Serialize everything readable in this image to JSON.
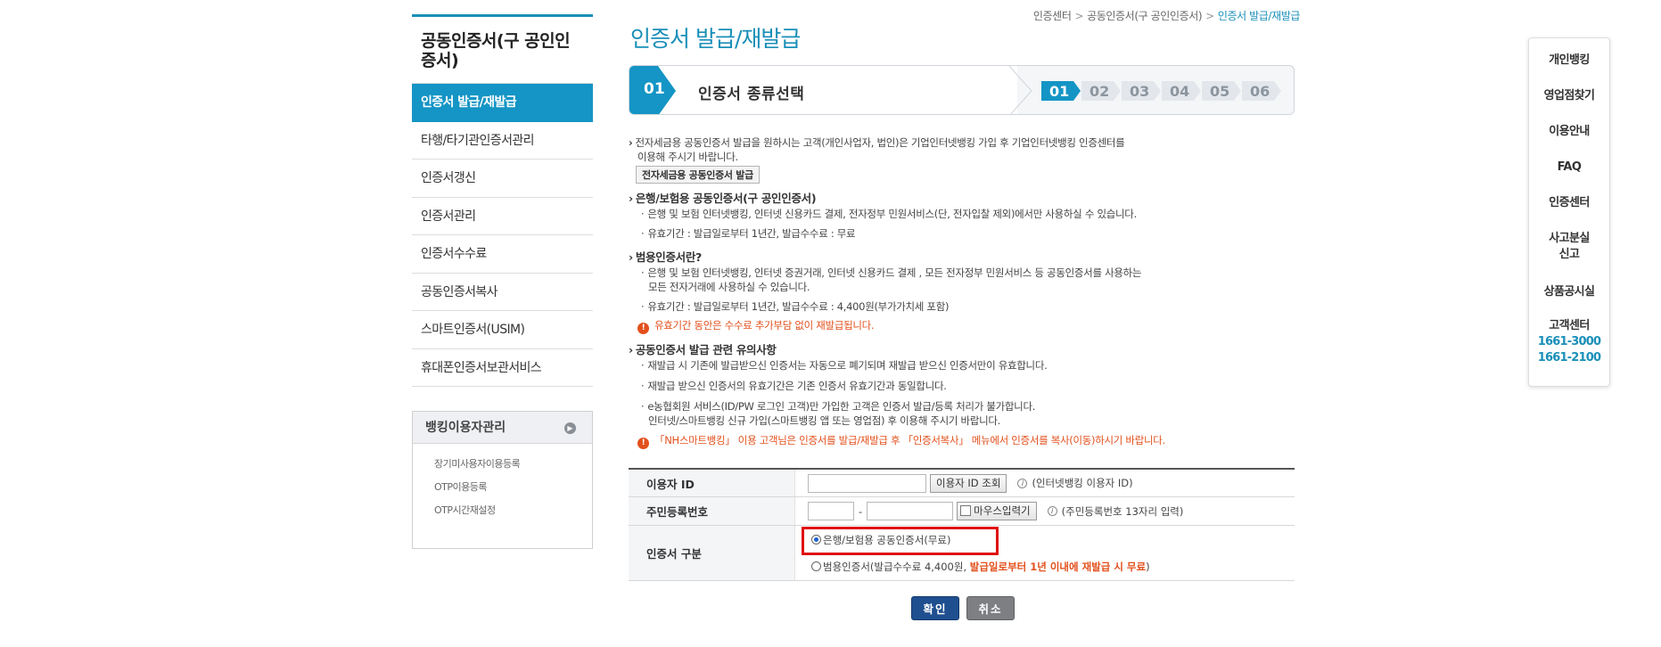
{
  "sidebar": {
    "title": "공동인증서(구 공인인증서)",
    "items": [
      {
        "label": "인증서 발급/재발급",
        "active": true
      },
      {
        "label": "타행/타기관인증서관리"
      },
      {
        "label": "인증서갱신"
      },
      {
        "label": "인증서관리"
      },
      {
        "label": "인증서수수료"
      },
      {
        "label": "공동인증서복사"
      },
      {
        "label": "스마트인증서(USIM)"
      },
      {
        "label": "휴대폰인증서보관서비스"
      }
    ],
    "box": {
      "title": "뱅킹이용자관리",
      "links": [
        "장기미사용자이용등록",
        "OTP이용등록",
        "OTP시간재설정"
      ]
    }
  },
  "breadcrumb": [
    "인증센터",
    "공동인증서(구 공인인증서)",
    "인증서 발급/재발급"
  ],
  "page_title": "인증서 발급/재발급",
  "stepbar": {
    "current_num": "01",
    "current_label": "인증서 종류선택",
    "steps": [
      "01",
      "02",
      "03",
      "04",
      "05",
      "06"
    ]
  },
  "content": {
    "intro_line1": "전자세금용 공동인증서 발급을 원하시는 고객(개인사업자, 법인)은 기업인터넷뱅킹 가입 후 기업인터넷뱅킹 인증센터를",
    "intro_line2": "이용해 주시기 바랍니다.",
    "intro_button": "전자세금용 공동인증서 발급",
    "sec1_title": "은행/보험용 공동인증서(구 공인인증서)",
    "sec1_l1": "은행 및 보험 인터넷뱅킹, 인터넷 신용카드 결제, 전자정부 민원서비스(단, 전자입찰 제외)에서만 사용하실 수 있습니다.",
    "sec1_l2": "유효기간 : 발급일로부터 1년간, 발급수수료 : 무료",
    "sec2_title": "범용인증서란?",
    "sec2_l1a": "은행 및 보험 인터넷뱅킹, 인터넷 증권거래, 인터넷 신용카드 결제 , 모든 전자정부 민원서비스 등 공동인증서를 사용하는",
    "sec2_l1b": "모든 전자거래에 사용하실 수 있습니다.",
    "sec2_l2": "유효기간 : 발급일로부터 1년간, 발급수수료 : 4,400원(부가가치세 포함)",
    "sec2_warn": "유효기간 동안은 수수료 추가부담 없이 재발급됩니다.",
    "sec3_title": "공동인증서 발급 관련 유의사항",
    "sec3_l1": "재발급 시 기존에 발급받으신 인증서는 자동으로 폐기되며 재발급 받으신 인증서만이 유효합니다.",
    "sec3_l2": "재발급 받으신 인증서의 유효기간은 기존 인증서 유효기간과 동일합니다.",
    "sec3_l3a": "e농협회원 서비스(ID/PW 로그인 고객)만 가입한 고객은 인증서 발급/등록 처리가 불가합니다.",
    "sec3_l3b": "인터넷/스마트뱅킹 신규 가입(스마트뱅킹 앱 또는 영업점) 후 이용해 주시기 바랍니다.",
    "sec3_warn": "「NH스마트뱅킹」 이용 고객님은 인증서를 발급/재발급 후 「인증서복사」 메뉴에서 인증서를 복사(이동)하시기 바랍니다."
  },
  "form": {
    "user_id_label": "이용자 ID",
    "user_id_button": "이용자 ID 조회",
    "user_id_help": "(인터넷뱅킹 이용자 ID)",
    "rrn_label": "주민등록번호",
    "rrn_dash": "-",
    "rrn_mouse": "마우스입력기",
    "rrn_help": "(주민등록번호 13자리 입력)",
    "cert_type_label": "인증서 구분",
    "opt1": "은행/보험용 공동인증서(무료)",
    "opt2_prefix": "범용인증서(발급수수료 4,400원,",
    "opt2_bold": "발급일로부터 1년 이내에 재발급 시 무료",
    "opt2_suffix": ")"
  },
  "actions": {
    "ok": "확인",
    "cancel": "취소"
  },
  "quick_menu": [
    "개인뱅킹",
    "영업점찾기",
    "이용안내",
    "FAQ",
    "인증센터",
    "사고분실",
    "신고",
    "상품공시실",
    "고객센터"
  ],
  "phones": [
    "1661-3000",
    "1661-2100"
  ],
  "colors": {
    "accent": "#1495c5",
    "warn": "#e2501c",
    "highlight": "#e01010",
    "ok_button": "#1f4f8f"
  }
}
